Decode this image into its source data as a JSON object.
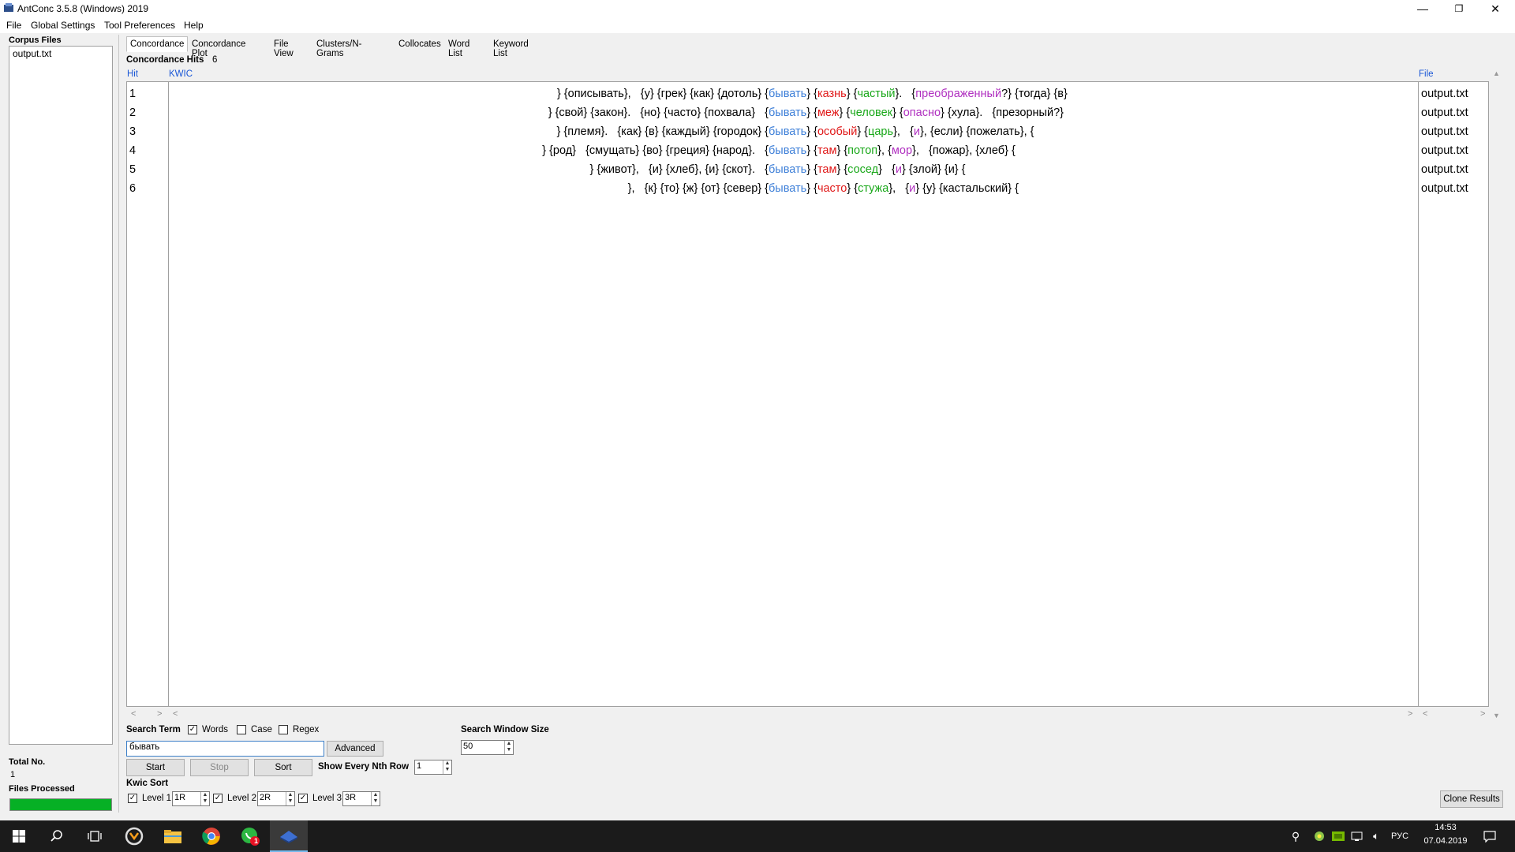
{
  "window": {
    "title": "AntConc 3.5.8 (Windows) 2019",
    "minimize": "—",
    "restore": "❐",
    "close": "✕"
  },
  "menu": [
    "File",
    "Global Settings",
    "Tool Preferences",
    "Help"
  ],
  "left_panel": {
    "corpus_files_label": "Corpus Files",
    "files": [
      "output.txt"
    ],
    "total_no_label": "Total No.",
    "total_no": "1",
    "files_processed_label": "Files Processed",
    "progress": 1.0
  },
  "tabs": [
    "Concordance",
    "Concordance Plot",
    "File View",
    "Clusters/N-Grams",
    "Collocates",
    "Word List",
    "Keyword List"
  ],
  "active_tab": "Concordance",
  "results": {
    "hits_label": "Concordance Hits",
    "hits_count": "6",
    "col_hit": "Hit",
    "col_kwic": "KWIC",
    "col_file": "File",
    "rows": [
      {
        "hit": "1",
        "left": "} {описывать},   {у} {грек} {как} {дотоль} {",
        "key": "бывать",
        "r1": "} {",
        "w1": "казнь",
        "r2": "} {",
        "w2": "частый",
        "r3": "}.   {",
        "w3": "преображенный",
        "rest": "?} {тогда} {в}",
        "file": "output.txt"
      },
      {
        "hit": "2",
        "left": "} {свой} {закон}.   {но} {часто} {похвала}   {",
        "key": "бывать",
        "r1": "} {",
        "w1": "меж",
        "r2": "} {",
        "w2": "человек",
        "r3": "} {",
        "w3": "опасно",
        "rest": "} {хула}.   {презорный?}",
        "file": "output.txt"
      },
      {
        "hit": "3",
        "left": "} {племя}.   {как} {в} {каждый} {городок} {",
        "key": "бывать",
        "r1": "} {",
        "w1": "особый",
        "r2": "} {",
        "w2": "царь",
        "r3": "},   {",
        "w3": "и",
        "rest": "}, {если} {пожелать}, {",
        "file": "output.txt"
      },
      {
        "hit": "4",
        "left": "} {род}   {смущать} {во} {греция} {народ}.   {",
        "key": "бывать",
        "r1": "} {",
        "w1": "там",
        "r2": "} {",
        "w2": "потоп",
        "r3": "}, {",
        "w3": "мор",
        "rest": "},   {пожар}, {хлеб} {",
        "file": "output.txt"
      },
      {
        "hit": "5",
        "left": "} {живот},   {и} {хлеб}, {и} {скот}.   {",
        "key": "бывать",
        "r1": "} {",
        "w1": "там",
        "r2": "} {",
        "w2": "сосед",
        "r3": "}   {",
        "w3": "и",
        "rest": "} {злой} {и} {",
        "file": "output.txt"
      },
      {
        "hit": "6",
        "left": "},   {к} {то} {ж} {от} {север} {",
        "key": "бывать",
        "r1": "} {",
        "w1": "часто",
        "r2": "} {",
        "w2": "стужа",
        "r3": "},   {",
        "w3": "и",
        "rest": "} {у} {кастальский} {",
        "file": "output.txt"
      }
    ]
  },
  "search": {
    "search_term_label": "Search Term",
    "words_label": "Words",
    "words_checked": true,
    "case_label": "Case",
    "case_checked": false,
    "regex_label": "Regex",
    "regex_checked": false,
    "term_value": "бывать",
    "advanced_label": "Advanced",
    "window_size_label": "Search Window Size",
    "window_size_value": "50",
    "start_label": "Start",
    "stop_label": "Stop",
    "sort_label": "Sort",
    "nth_row_label": "Show Every Nth Row",
    "nth_row_value": "1",
    "kwic_sort_label": "Kwic Sort",
    "levels": [
      {
        "label": "Level 1",
        "value": "1R",
        "checked": true
      },
      {
        "label": "Level 2",
        "value": "2R",
        "checked": true
      },
      {
        "label": "Level 3",
        "value": "3R",
        "checked": true
      }
    ],
    "clone_label": "Clone Results"
  },
  "taskbar": {
    "lang": "РУС",
    "time": "14:53",
    "date": "07.04.2019",
    "badge": "1",
    "icons": [
      "windows-start-icon",
      "search-icon",
      "task-view-icon",
      "overwatch-icon",
      "file-explorer-icon",
      "chrome-icon",
      "whatsapp-icon",
      "antconc-icon"
    ]
  },
  "colors": {
    "keyword": "#3d7fd8",
    "r1": "#e01818",
    "r2": "#1aa81a",
    "r3": "#b030c0",
    "progress": "#06b025"
  }
}
